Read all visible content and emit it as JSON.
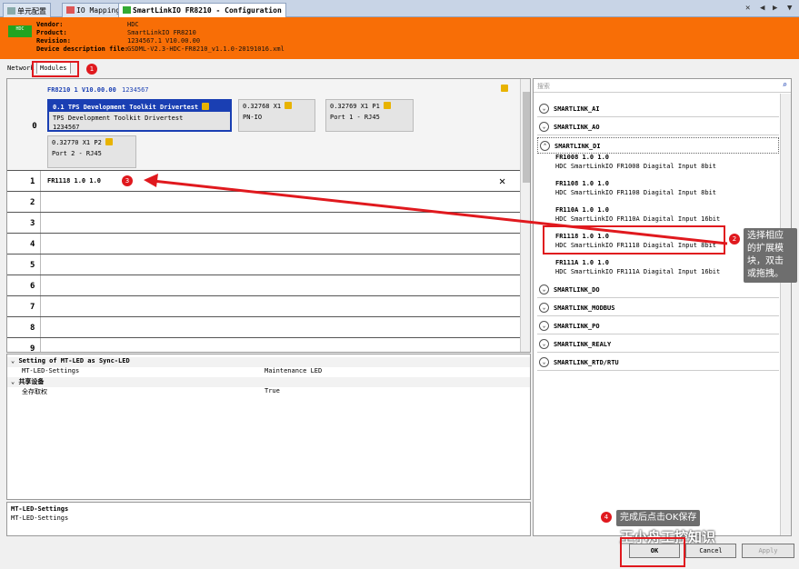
{
  "tabs": [
    {
      "label": "单元配置"
    },
    {
      "label": "IO Mapping"
    },
    {
      "label": "SmartLinkIO FR8210 - Configuration"
    }
  ],
  "header": {
    "vendor_label": "Vendor:",
    "vendor": "HDC",
    "product_label": "Product:",
    "product": "SmartLinkIO FR8210",
    "revision_label": "Revision:",
    "revision": "1234567.1 V10.00.00",
    "devdesc_label": "Device description file:",
    "devdesc": "GSDML-V2.3-HDC-FR8210_v1.1.0-20191016.xml",
    "logo_text": "HDC"
  },
  "subtabs": [
    {
      "label": "Network"
    },
    {
      "label": "Modules"
    }
  ],
  "annotations": {
    "b1": "1",
    "b2": "2",
    "b3": "3",
    "b4": "4"
  },
  "slot0": {
    "num": "0",
    "device": "FR8210 1 V10.00.00",
    "device_id": "1234567",
    "modules": [
      {
        "head": "0.1  TPS Development Toolkit Drivertest",
        "body1": "TPS Development Toolkit Drivertest",
        "body2": "1234567"
      },
      {
        "head": "0.32768  X1",
        "body1": "PN-IO",
        "body2": ""
      },
      {
        "head": "0.32769  X1 P1",
        "body1": "Port 1 - RJ45",
        "body2": ""
      },
      {
        "head": "0.32770  X1 P2",
        "body1": "Port 2 - RJ45",
        "body2": ""
      }
    ]
  },
  "slots": [
    {
      "num": "1",
      "module": "FR1118 1.0 1.0"
    },
    {
      "num": "2",
      "module": ""
    },
    {
      "num": "3",
      "module": ""
    },
    {
      "num": "4",
      "module": ""
    },
    {
      "num": "5",
      "module": ""
    },
    {
      "num": "6",
      "module": ""
    },
    {
      "num": "7",
      "module": ""
    },
    {
      "num": "8",
      "module": ""
    },
    {
      "num": "9",
      "module": ""
    }
  ],
  "props": {
    "group1": "Setting of MT-LED as Sync-LED",
    "row1_name": "MT-LED-Settings",
    "row1_val": "Maintenance LED",
    "group2": "共享设备",
    "row2_name": "全存取权",
    "row2_val": "True"
  },
  "desc": {
    "title": "MT-LED-Settings",
    "text": "MT-LED-Settings"
  },
  "catalog": {
    "search_placeholder": "搜索",
    "cats": [
      "SMARTLINK_AI",
      "SMARTLINK_AO",
      "SMARTLINK_DI",
      "SMARTLINK_DO",
      "SMARTLINK_MODBUS",
      "SMARTLINK_PO",
      "SMARTLINK_REALY",
      "SMARTLINK_RTD/RTU"
    ],
    "items": [
      {
        "name": "FR1008 1.0 1.0",
        "desc": "HDC SmartLinkIO FR1008 Diagital Input 8bit"
      },
      {
        "name": "FR1108 1.0 1.0",
        "desc": "HDC SmartLinkIO FR1108 Diagital Input 8bit"
      },
      {
        "name": "FR110A 1.0 1.0",
        "desc": "HDC SmartLinkIO FR110A Diagital Input 16bit"
      },
      {
        "name": "FR1118 1.0 1.0",
        "desc": "HDC SmartLinkIO FR1118 Diagital Input 8bit"
      },
      {
        "name": "FR111A 1.0 1.0",
        "desc": "HDC SmartLinkIO FR111A Diagital Input 16bit"
      }
    ]
  },
  "callouts": {
    "select": [
      "选择相应",
      "的扩展模",
      "块，双击",
      "或拖拽。"
    ],
    "ok": "完成后点击OK保存"
  },
  "buttons": {
    "ok": "OK",
    "cancel": "Cancel",
    "apply": "Apply"
  },
  "watermark": "王小舟工控知识",
  "colors": {
    "header": "#f86e06",
    "selection": "#1a3fb3",
    "annotation": "#e0191e"
  }
}
